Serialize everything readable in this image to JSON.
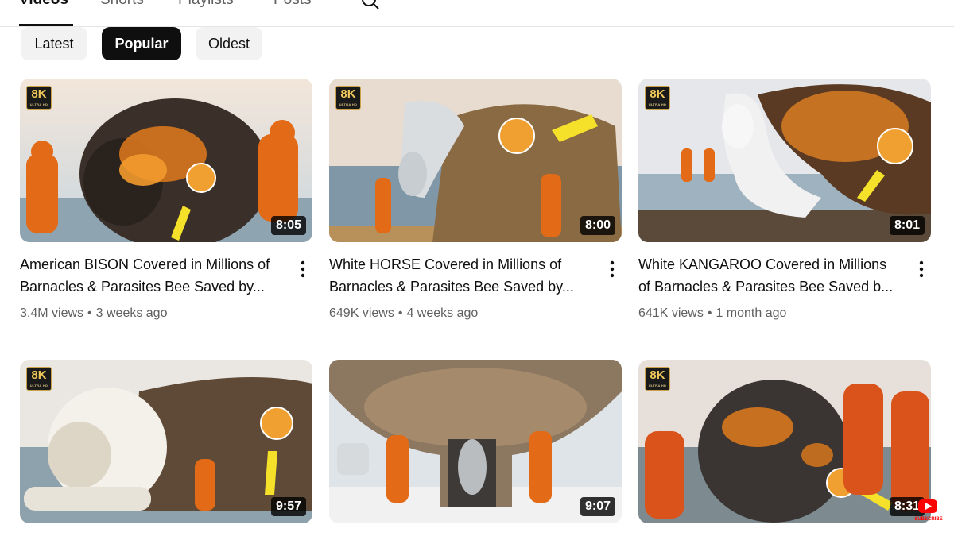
{
  "tabs": [
    {
      "label": "Videos",
      "active": true
    },
    {
      "label": "Shorts",
      "active": false
    },
    {
      "label": "Playlists",
      "active": false
    },
    {
      "label": "Posts",
      "active": false
    }
  ],
  "search_icon": "search-icon",
  "sort_chips": [
    {
      "label": "Latest",
      "selected": false
    },
    {
      "label": "Popular",
      "selected": true
    },
    {
      "label": "Oldest",
      "selected": false
    }
  ],
  "videos": [
    {
      "title_line1": "American BISON Covered in Millions of",
      "title_line2": "Barnacles & Parasites Bee Saved by...",
      "views": "3.4M views",
      "age": "3 weeks ago",
      "duration": "8:05",
      "badge": "8K",
      "badge_sub": "ULTRA HD"
    },
    {
      "title_line1": "White HORSE Covered in Millions of",
      "title_line2": "Barnacles & Parasites Bee Saved by...",
      "views": "649K views",
      "age": "4 weeks ago",
      "duration": "8:00",
      "badge": "8K",
      "badge_sub": "ULTRA HD"
    },
    {
      "title_line1": "White KANGAROO Covered in Millions",
      "title_line2": "of Barnacles & Parasites Bee Saved b...",
      "views": "641K views",
      "age": "1 month ago",
      "duration": "8:01",
      "badge": "8K",
      "badge_sub": "ULTRA HD"
    },
    {
      "duration": "9:57",
      "badge": "8K",
      "badge_sub": "ULTRA HD"
    },
    {
      "duration": "9:07"
    },
    {
      "duration": "8:31",
      "badge": "8K",
      "badge_sub": "ULTRA HD"
    }
  ],
  "separator": "•",
  "subscribe_mark": "SUBSCRIBE"
}
